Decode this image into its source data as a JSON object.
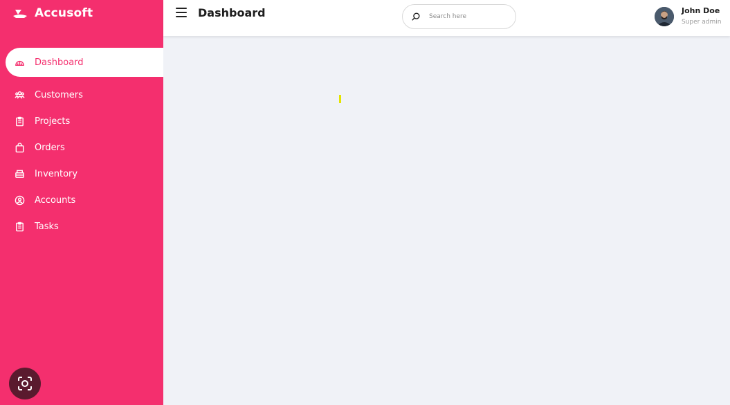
{
  "brand": {
    "name": "Accusoft",
    "logo": "boat-logo-icon"
  },
  "sidebar": {
    "items": [
      {
        "label": "Dashboard",
        "icon": "dashboard-icon",
        "active": true
      },
      {
        "label": "Customers",
        "icon": "users-icon"
      },
      {
        "label": "Projects",
        "icon": "clipboard-icon"
      },
      {
        "label": "Orders",
        "icon": "bag-icon"
      },
      {
        "label": "Inventory",
        "icon": "inventory-icon"
      },
      {
        "label": "Accounts",
        "icon": "user-circle-icon"
      },
      {
        "label": "Tasks",
        "icon": "tasks-icon"
      }
    ]
  },
  "header": {
    "title": "Dashboard",
    "search": {
      "placeholder": "Search here",
      "value": ""
    },
    "user": {
      "name": "John Doe",
      "role": "Super admin"
    }
  },
  "colors": {
    "accent": "#f42f6e",
    "background": "#f0f2f7",
    "surface": "#ffffff"
  }
}
